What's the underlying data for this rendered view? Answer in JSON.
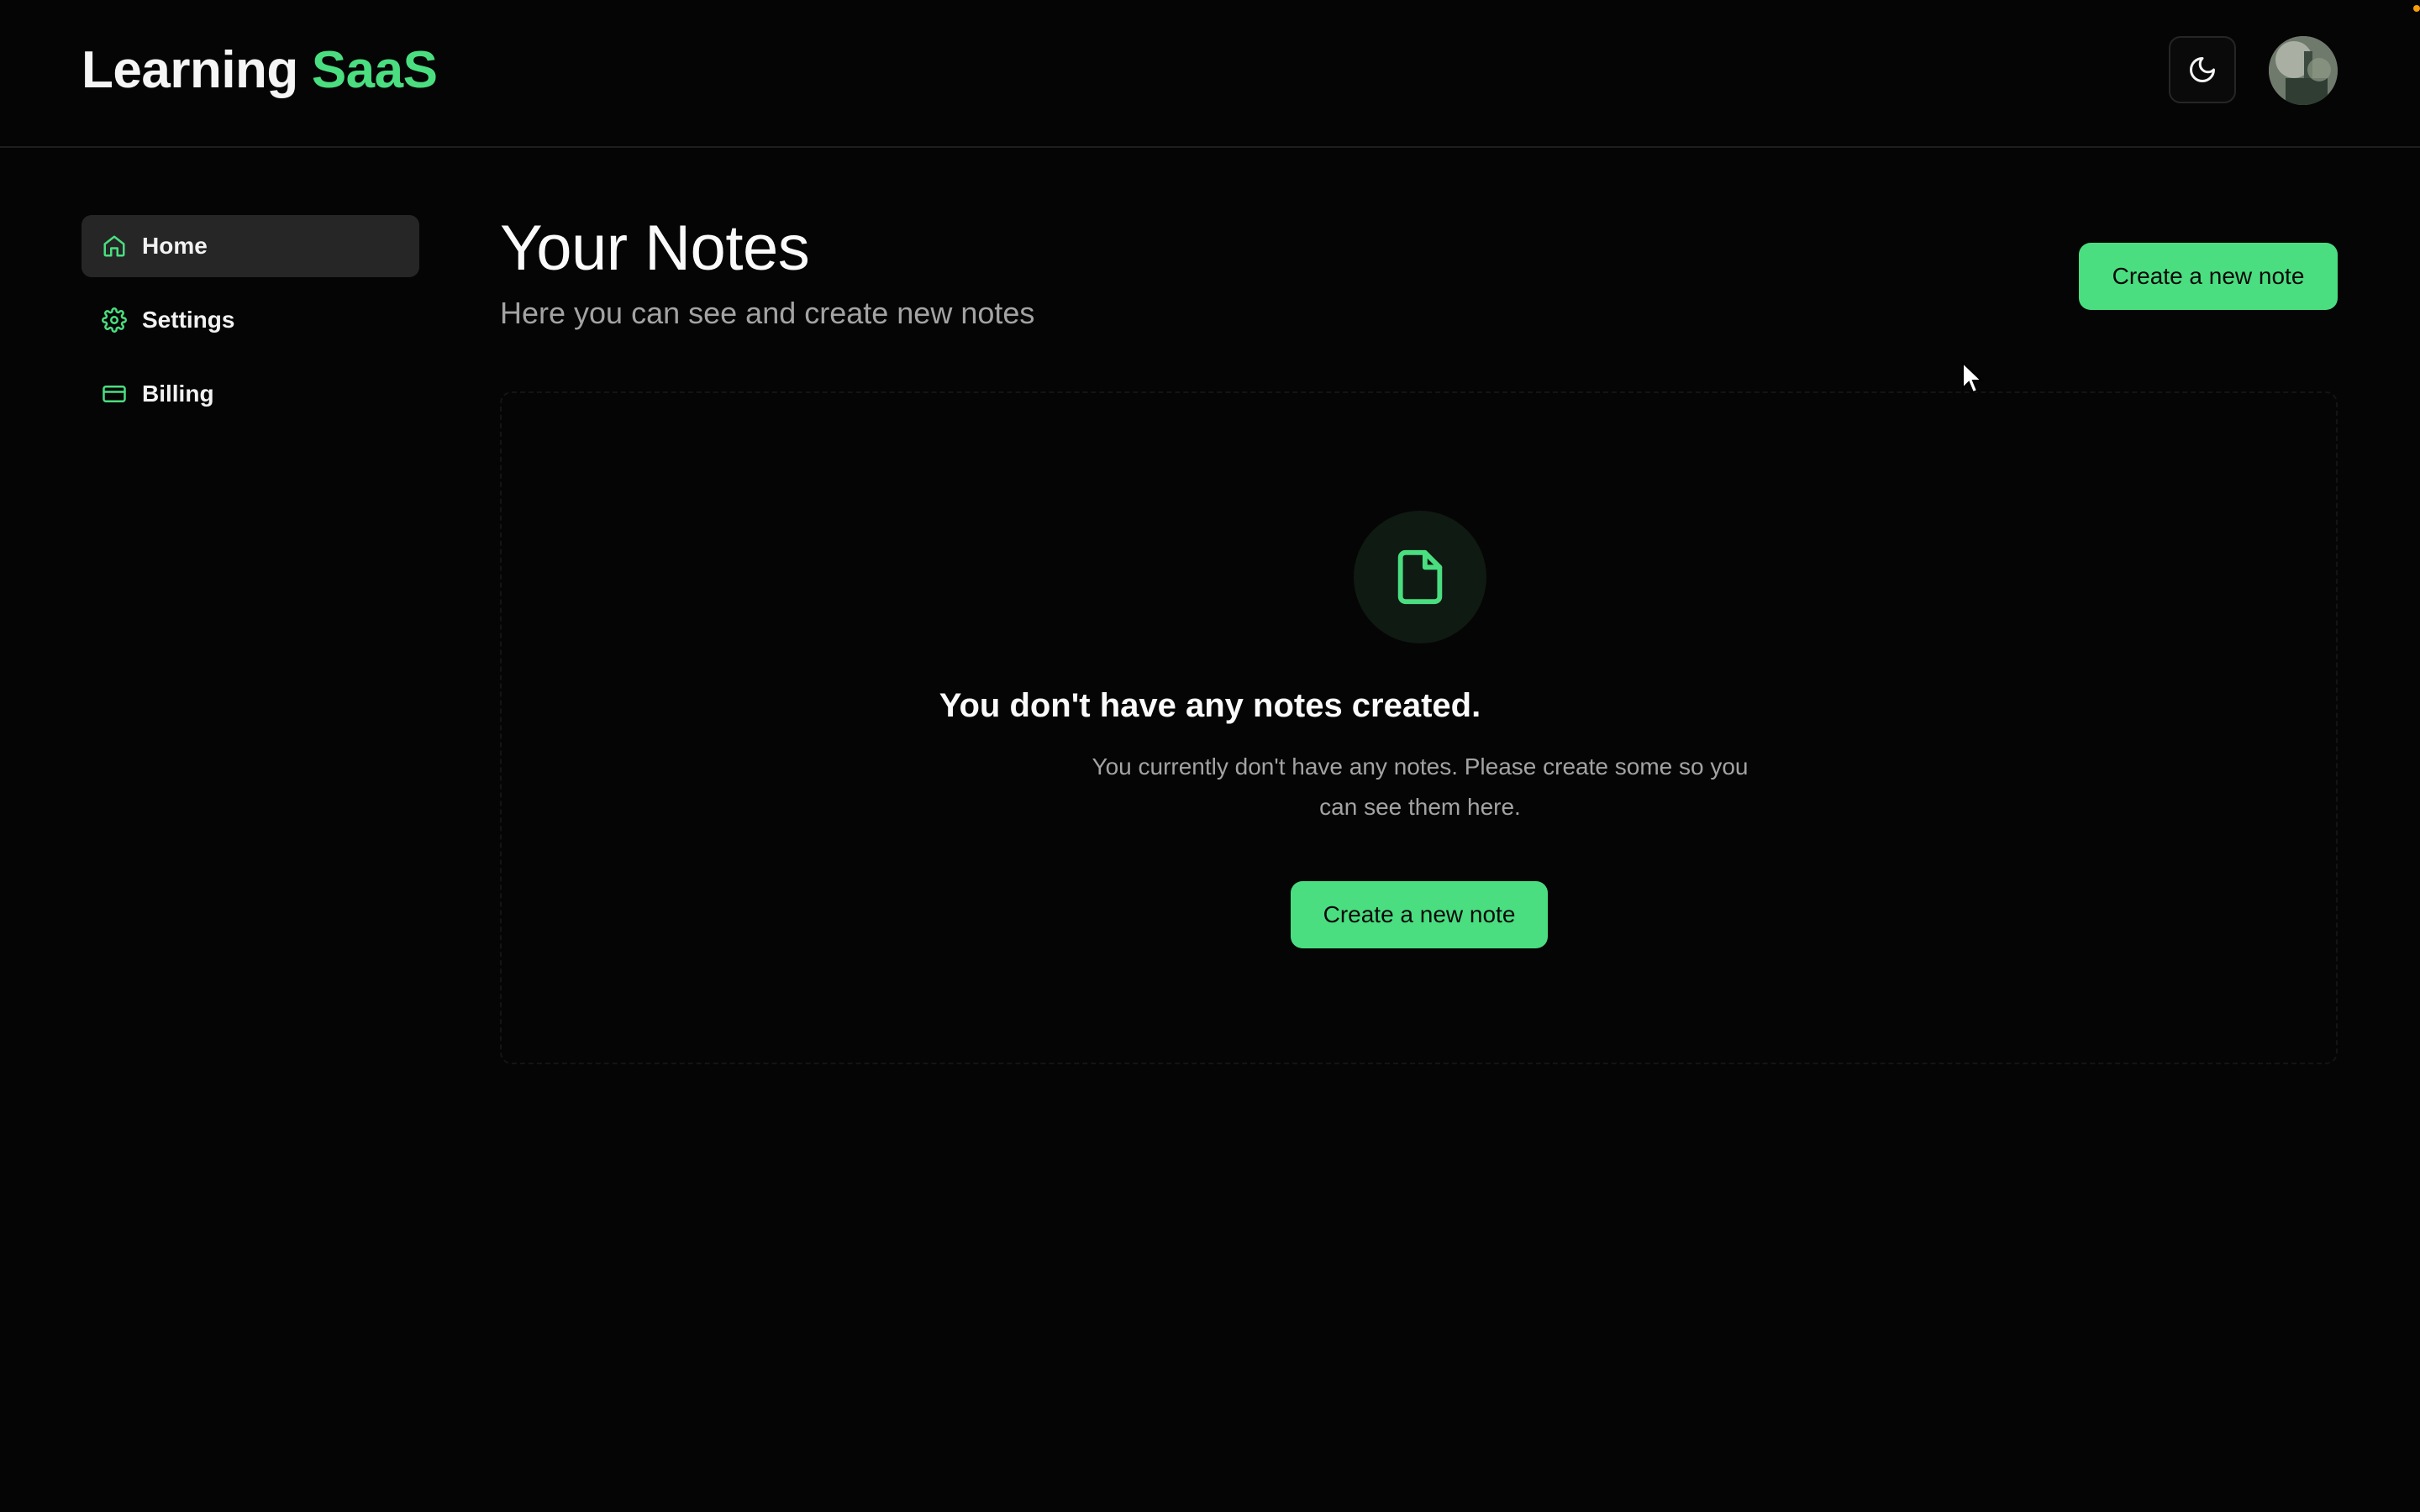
{
  "app": {
    "logo_part1": "Learning",
    "logo_part2": "SaaS",
    "accent_color": "#4ade80"
  },
  "header": {
    "theme_toggle_icon": "moon-icon",
    "avatar_alt": "User avatar"
  },
  "sidebar": {
    "items": [
      {
        "label": "Home",
        "icon": "home-icon",
        "active": true
      },
      {
        "label": "Settings",
        "icon": "gear-icon",
        "active": false
      },
      {
        "label": "Billing",
        "icon": "credit-card-icon",
        "active": false
      }
    ]
  },
  "main": {
    "title": "Your Notes",
    "subtitle": "Here you can see and create new notes",
    "create_button_label": "Create a new note"
  },
  "empty_state": {
    "icon": "file-icon",
    "title": "You don't have any notes created.",
    "description": "You currently don't have any notes. Please create some so you can see them here.",
    "button_label": "Create a new note"
  }
}
